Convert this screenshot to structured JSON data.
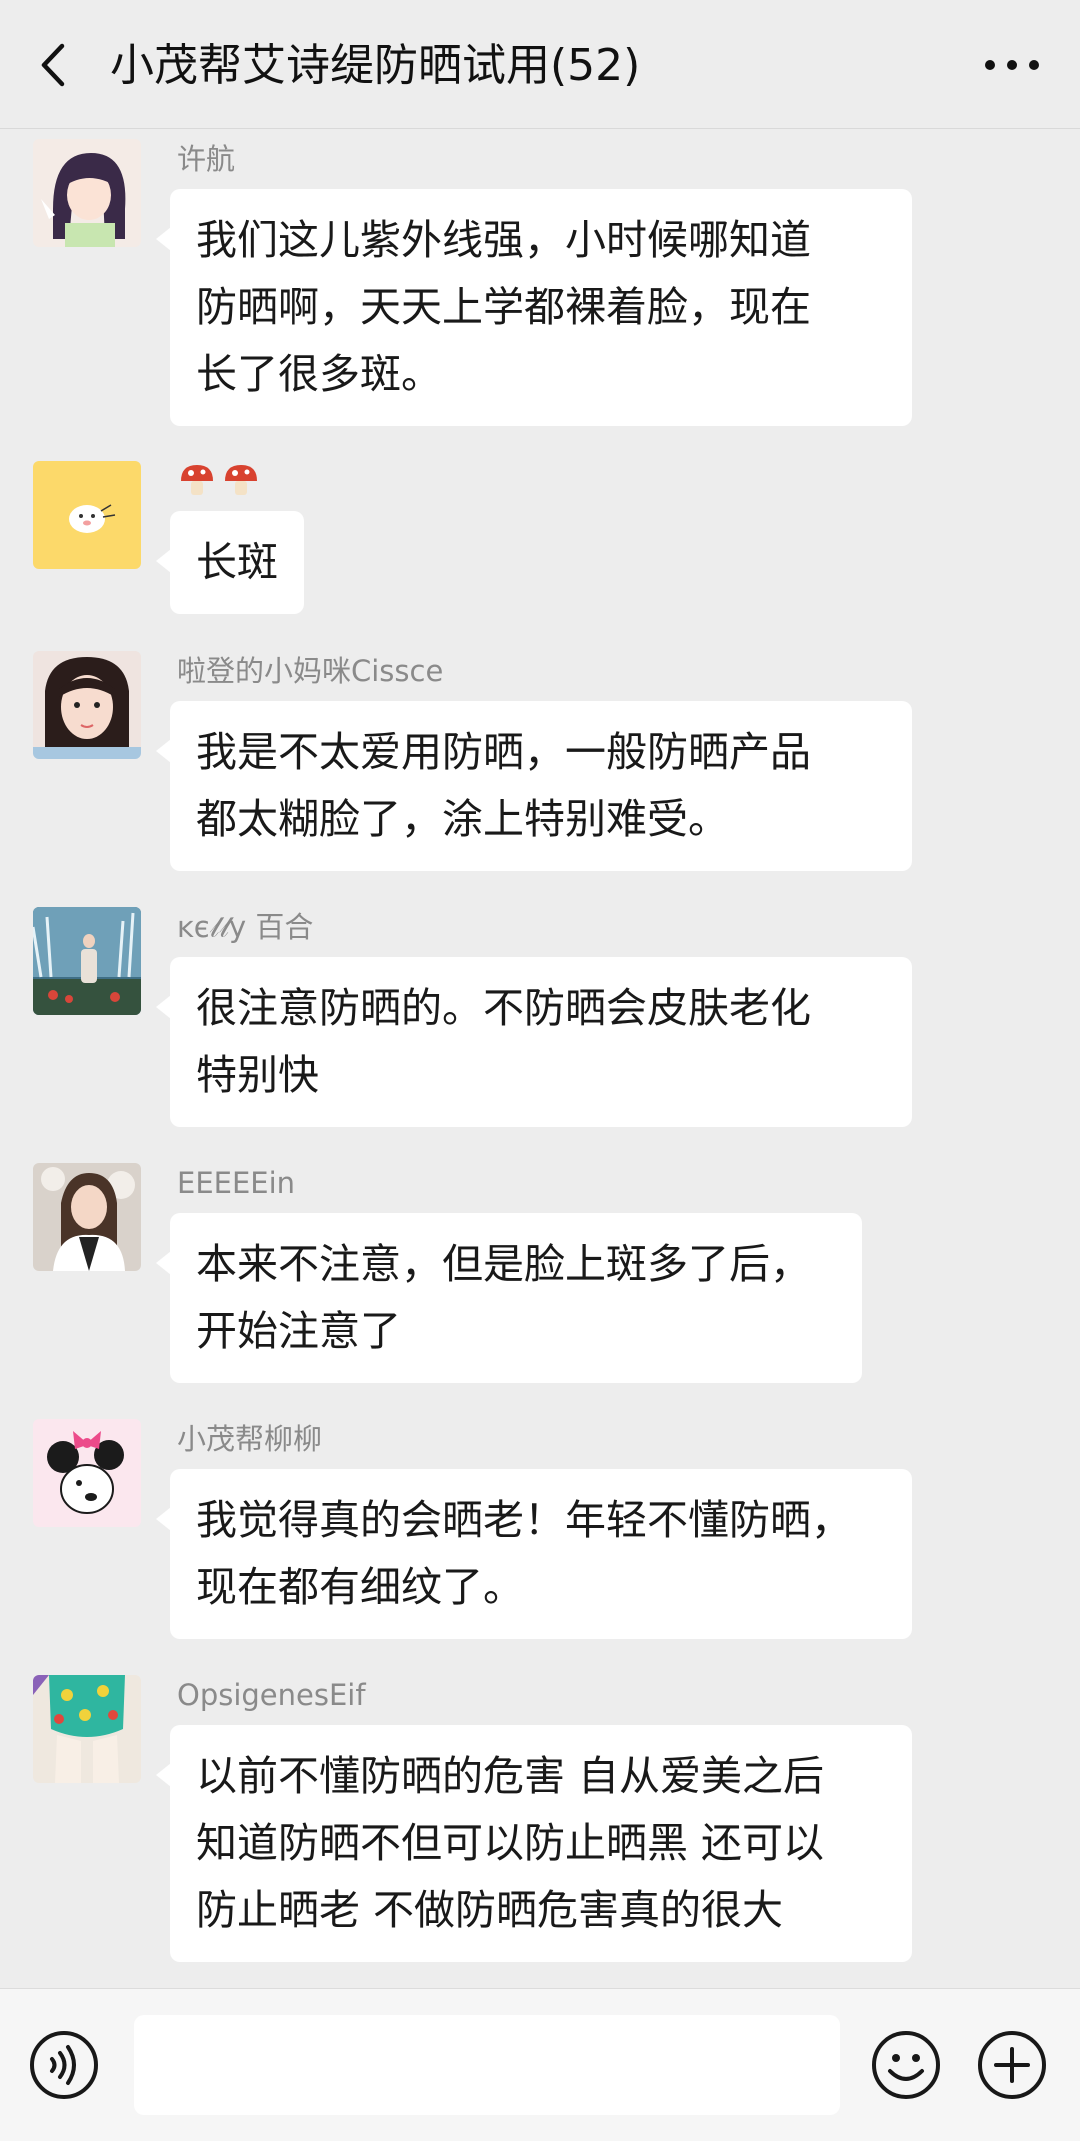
{
  "header": {
    "title": "小茂帮艾诗缇防晒试用(52)"
  },
  "messages": [
    {
      "sender": "许航",
      "text": "我们这儿紫外线强，小时候哪知道\n防晒啊，天天上学都裸着脸，现在\n长了很多斑。"
    },
    {
      "sender": "",
      "sender_icons": [
        "mushroom-icon",
        "mushroom-icon"
      ],
      "text": "长斑"
    },
    {
      "sender": "啦登的小妈咪Cissce",
      "text": "我是不太爱用防晒，一般防晒产品\n都太糊脸了，涂上特别难受。"
    },
    {
      "sender": "ĸє𝓁𝓁y 百合",
      "text": "很注意防晒的。不防晒会皮肤老化\n特别快"
    },
    {
      "sender": "EEEEEin",
      "text": "本来不注意，但是脸上斑多了后，\n开始注意了"
    },
    {
      "sender": "小茂帮柳柳",
      "text": "我觉得真的会晒老！年轻不懂防晒，\n现在都有细纹了。"
    },
    {
      "sender": "OpsigenesEif",
      "text": "以前不懂防晒的危害 自从爱美之后\n知道防晒不但可以防止晒黑 还可以\n防止晒老 不做防晒危害真的很大"
    }
  ],
  "footer": {
    "input_value": ""
  },
  "icons": {
    "back": "chevron-left-icon",
    "more": "more-dots-icon",
    "voice": "voice-icon",
    "emoji": "emoji-icon",
    "plus": "plus-icon"
  }
}
